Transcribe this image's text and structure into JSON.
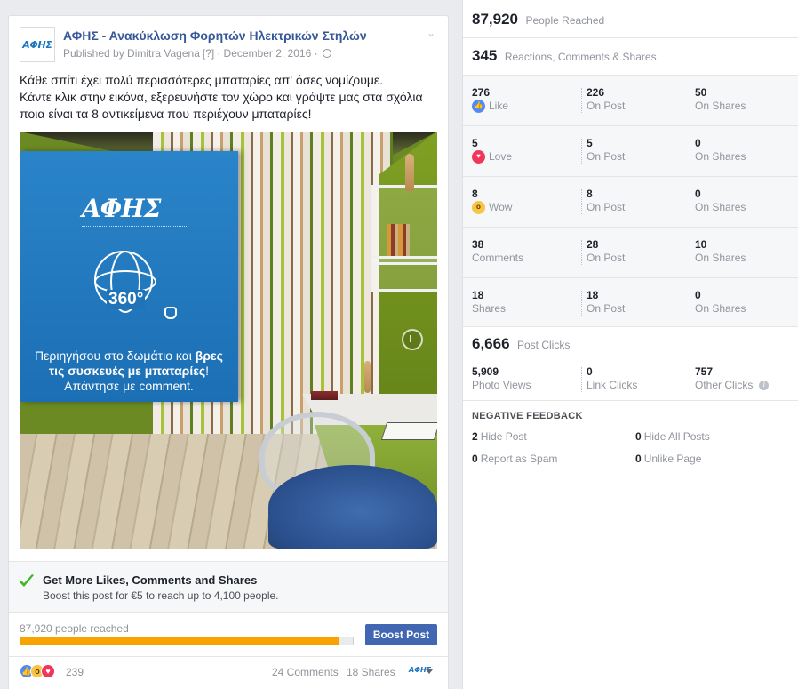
{
  "post": {
    "page_name": "ΑΦΗΣ - Ανακύκλωση Φορητών Ηλεκτρικών Στηλών",
    "logo_text": "ΑΦΗΣ",
    "published_by": "Published by Dimitra Vagena",
    "help_marker": "[?]",
    "date": "· December 2, 2016 ·",
    "text_lines": [
      "Κάθε σπίτι έχει πολύ περισσότερες μπαταρίες απ' όσες νομίζουμε.",
      "Κάντε κλικ στην εικόνα, εξερευνήστε τον χώρο και γράψτε μας στα σχόλια",
      "ποια είναι τα 8 αντικείμενα που περιέχουν μπαταρίες!"
    ],
    "image": {
      "banner_logo": "ΑΦΗΣ",
      "label_360": "360°",
      "line1_prefix": "Περιηγήσου στο δωμάτιο και ",
      "line1_bold": "βρες",
      "line2_bold": "τις συσκευές με μπαταρίες",
      "line2_suffix": "!",
      "line3": "Απάντησε με comment."
    },
    "boost": {
      "title": "Get More Likes, Comments and Shares",
      "description": "Boost this post for €5 to reach up to 4,100 people.",
      "reach_label": "87,920 people reached",
      "progress_pct": 96,
      "button_label": "Boost Post"
    },
    "footer": {
      "reaction_count": "239",
      "comments": "24 Comments",
      "shares": "18 Shares",
      "page_icon_text": "ΑΦΗΣ"
    }
  },
  "insights": {
    "reached": {
      "value": "87,920",
      "label": "People Reached"
    },
    "reactions": {
      "value": "345",
      "label": "Reactions, Comments & Shares"
    },
    "rows": [
      {
        "icon": "like-icon",
        "total": "276",
        "label": "Like",
        "on_post": "226",
        "on_post_label": "On Post",
        "on_shares": "50",
        "on_shares_label": "On Shares"
      },
      {
        "icon": "love-icon",
        "total": "5",
        "label": "Love",
        "on_post": "5",
        "on_post_label": "On Post",
        "on_shares": "0",
        "on_shares_label": "On Shares"
      },
      {
        "icon": "wow-icon",
        "total": "8",
        "label": "Wow",
        "on_post": "8",
        "on_post_label": "On Post",
        "on_shares": "0",
        "on_shares_label": "On Shares"
      },
      {
        "icon": "",
        "total": "38",
        "label": "Comments",
        "on_post": "28",
        "on_post_label": "On Post",
        "on_shares": "10",
        "on_shares_label": "On Shares"
      },
      {
        "icon": "",
        "total": "18",
        "label": "Shares",
        "on_post": "18",
        "on_post_label": "On Post",
        "on_shares": "0",
        "on_shares_label": "On Shares"
      }
    ],
    "clicks": {
      "value": "6,666",
      "label": "Post Clicks",
      "photo_views": "5,909",
      "photo_views_label": "Photo Views",
      "link_clicks": "0",
      "link_clicks_label": "Link Clicks",
      "other_clicks": "757",
      "other_clicks_label": "Other Clicks"
    },
    "negative": {
      "title": "NEGATIVE FEEDBACK",
      "hide_post": "2",
      "hide_post_label": "Hide Post",
      "hide_all": "0",
      "hide_all_label": "Hide All Posts",
      "spam": "0",
      "spam_label": "Report as Spam",
      "unlike": "0",
      "unlike_label": "Unlike Page"
    }
  }
}
